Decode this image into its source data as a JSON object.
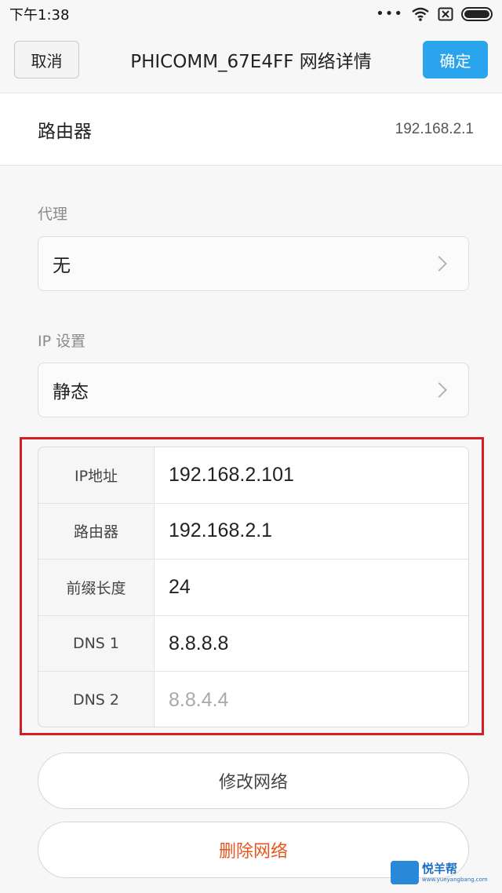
{
  "status_bar": {
    "time": "下午1:38",
    "icons": [
      "more-dots-icon",
      "wifi-icon",
      "sim-blocked-icon",
      "battery-icon"
    ]
  },
  "title_bar": {
    "cancel_label": "取消",
    "title": "PHICOMM_67E4FF  网络详情",
    "confirm_label": "确定",
    "confirm_color": "#2aa4ed"
  },
  "router": {
    "label": "路由器",
    "value": "192.168.2.1"
  },
  "proxy": {
    "section_label": "代理",
    "selected": "无"
  },
  "ip_settings": {
    "section_label": "IP 设置",
    "selected": "静态"
  },
  "static_config": {
    "highlight_color": "#d21f26",
    "rows": [
      {
        "label": "IP地址",
        "value": "192.168.2.101"
      },
      {
        "label": "路由器",
        "value": "192.168.2.1"
      },
      {
        "label": "前缀长度",
        "value": "24"
      },
      {
        "label": "DNS 1",
        "value": "8.8.8.8"
      },
      {
        "label": "DNS 2",
        "value": "8.8.4.4"
      }
    ]
  },
  "actions": {
    "modify_label": "修改网络",
    "delete_label": "删除网络",
    "delete_color": "#e8561f"
  },
  "watermark": {
    "title": "悦羊帮",
    "url": "www.yueyangbang.com"
  }
}
